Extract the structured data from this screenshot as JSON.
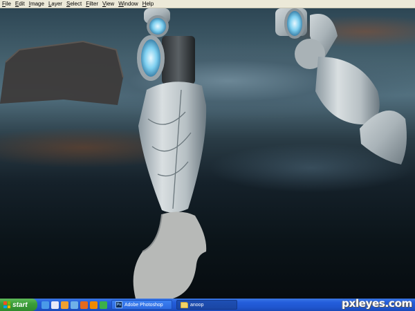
{
  "menubar": {
    "items": [
      {
        "label": "File",
        "accel": "F",
        "rest": "ile"
      },
      {
        "label": "Edit",
        "accel": "E",
        "rest": "dit"
      },
      {
        "label": "Image",
        "accel": "I",
        "rest": "mage"
      },
      {
        "label": "Layer",
        "accel": "L",
        "rest": "ayer"
      },
      {
        "label": "Select",
        "accel": "S",
        "rest": "elect"
      },
      {
        "label": "Filter",
        "accel": "F",
        "rest": "ilter"
      },
      {
        "label": "View",
        "accel": "V",
        "rest": "iew"
      },
      {
        "label": "Window",
        "accel": "W",
        "rest": "indow"
      },
      {
        "label": "Help",
        "accel": "H",
        "rest": "elp"
      }
    ]
  },
  "taskbar": {
    "start_label": "start",
    "quick_launch": [
      {
        "icon": "internet-explorer-icon",
        "color": "#4a9ae8"
      },
      {
        "icon": "outlook-express-icon",
        "color": "#e8e8f8"
      },
      {
        "icon": "windows-media-player-icon",
        "color": "#f0a030"
      },
      {
        "icon": "show-desktop-icon",
        "color": "#6fb0e8"
      },
      {
        "icon": "firefox-icon",
        "color": "#e36a1e"
      },
      {
        "icon": "vlc-icon",
        "color": "#f08a00"
      },
      {
        "icon": "messenger-icon",
        "color": "#3cb04a"
      }
    ],
    "tasks": [
      {
        "label": "Adobe Photoshop",
        "icon": "photoshop-icon",
        "active": true
      },
      {
        "label": "anoop",
        "icon": "folder-icon",
        "active": false
      }
    ]
  },
  "watermark": "pxleyes.com",
  "colors": {
    "menubar_bg": "#ece9d8",
    "taskbar_blue": "#245edb",
    "start_green": "#3c9f3a"
  }
}
